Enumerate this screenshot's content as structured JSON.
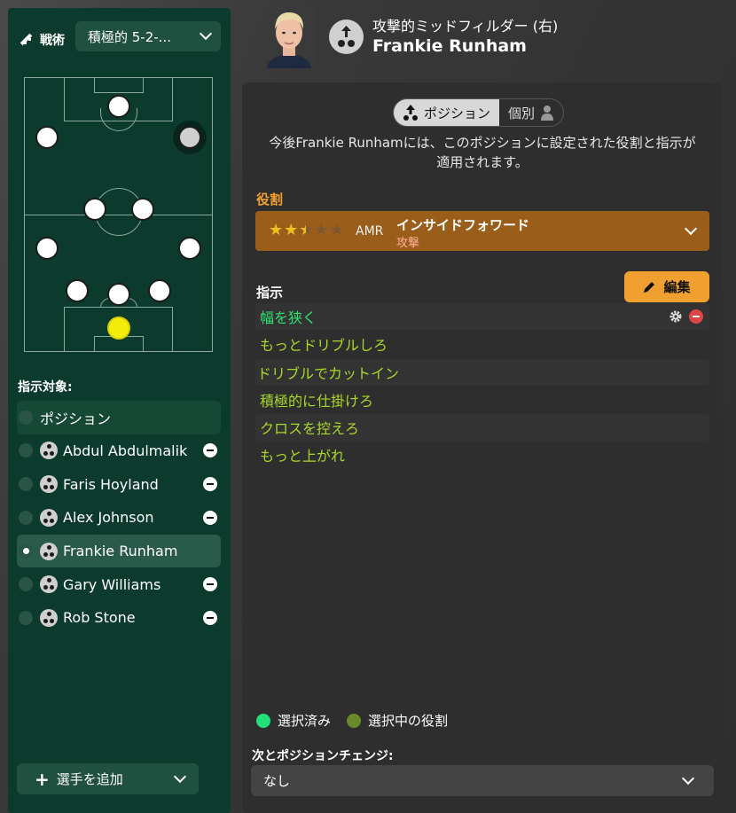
{
  "tactics": {
    "label": "戦術",
    "selected": "積極的 5-2-...",
    "icon": "tactics-icon"
  },
  "pitch": {
    "players": [
      {
        "role": "st",
        "highlight": false
      },
      {
        "role": "aml",
        "highlight": false
      },
      {
        "role": "amr",
        "highlight": true
      },
      {
        "role": "mcl",
        "highlight": false
      },
      {
        "role": "mcr",
        "highlight": false
      },
      {
        "role": "wbl",
        "highlight": false
      },
      {
        "role": "wbr",
        "highlight": false
      },
      {
        "role": "dcl",
        "highlight": false
      },
      {
        "role": "dc",
        "highlight": false
      },
      {
        "role": "dcr",
        "highlight": false
      },
      {
        "role": "gk",
        "highlight": false
      }
    ]
  },
  "target_section": {
    "title": "指示対象:",
    "items": [
      {
        "label": "ポジション",
        "type": "position",
        "selected": false,
        "removable": false
      },
      {
        "label": "Abdul Abdulmalik",
        "type": "player",
        "selected": false,
        "removable": true
      },
      {
        "label": "Faris Hoyland",
        "type": "player",
        "selected": false,
        "removable": true
      },
      {
        "label": "Alex Johnson",
        "type": "player",
        "selected": false,
        "removable": true
      },
      {
        "label": "Frankie Runham",
        "type": "player",
        "selected": true,
        "removable": false
      },
      {
        "label": "Gary Williams",
        "type": "player",
        "selected": false,
        "removable": true
      },
      {
        "label": "Rob Stone",
        "type": "player",
        "selected": false,
        "removable": true
      }
    ]
  },
  "add_player": {
    "label": "選手を追加"
  },
  "header": {
    "position": "攻撃的ミッドフィルダー (右)",
    "name": "Frankie Runham"
  },
  "toggle": {
    "position_label": "ポジション",
    "individual_label": "個別"
  },
  "info_line1": "今後Frankie Runhamには、このポジションに設定された役割と指示が",
  "info_line2": "適用されます。",
  "role": {
    "section_label": "役割",
    "stars": 2.5,
    "stars_max": 5,
    "position_code": "AMR",
    "name": "インサイドフォワード",
    "duty": "攻撃"
  },
  "instructions": {
    "section_label": "指示",
    "edit_label": "編集",
    "items": [
      {
        "label": "幅を狭く",
        "state": "selected"
      },
      {
        "label": "もっとドリブルしろ",
        "state": "role"
      },
      {
        "label": "ドリブルでカットイン",
        "state": "role"
      },
      {
        "label": "積極的に仕掛けろ",
        "state": "role"
      },
      {
        "label": "クロスを控えろ",
        "state": "role"
      },
      {
        "label": "もっと上がれ",
        "state": "role"
      }
    ]
  },
  "legend": {
    "selected_label": "選択済み",
    "selected_color": "#22e07a",
    "role_label": "選択中の役割",
    "role_color": "#6a8a2a"
  },
  "colors": {
    "selected_text": "#30e070",
    "role_text": "#a8d82a",
    "accent": "#f0a030"
  },
  "next_position": {
    "label": "次とポジションチェンジ:",
    "value": "なし"
  }
}
